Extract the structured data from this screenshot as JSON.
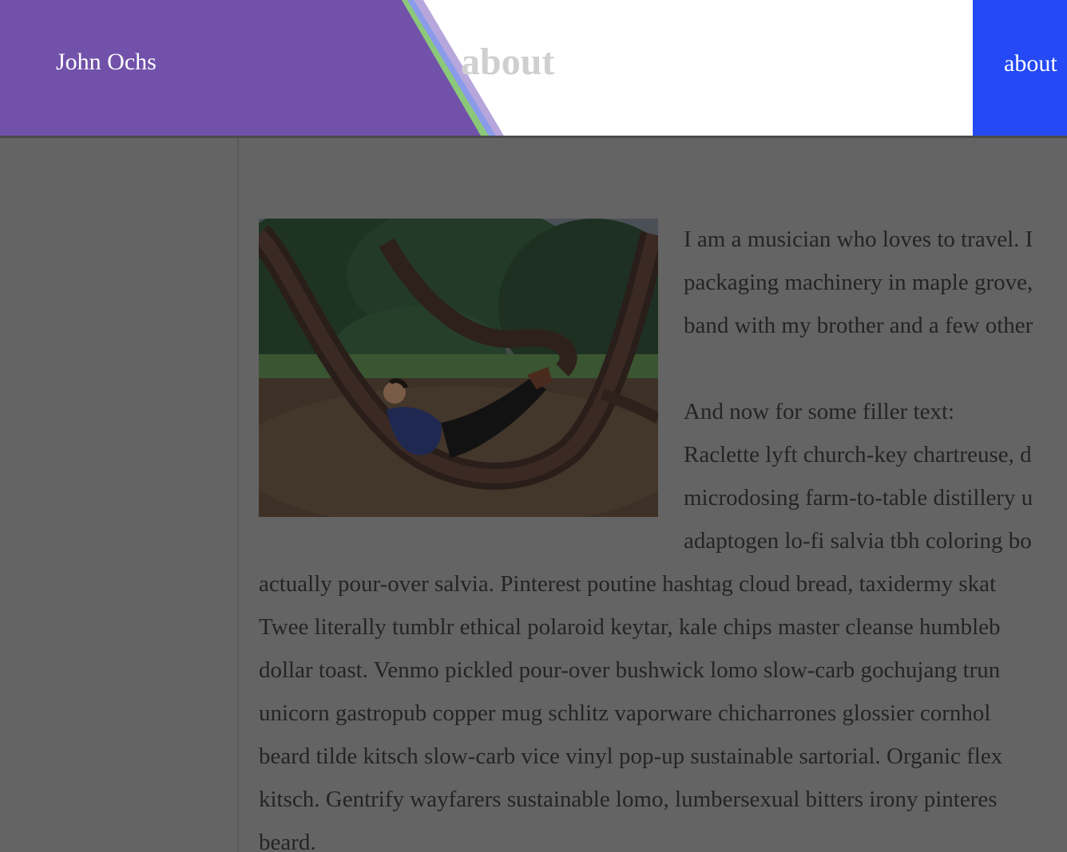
{
  "header": {
    "site_name": "John Ochs",
    "page_title": "about",
    "nav": [
      {
        "label": "about"
      }
    ]
  },
  "photo": {
    "alt": ""
  },
  "content": {
    "intro_lines": [
      "I am a musician who loves to travel. I",
      "packaging machinery in maple grove,",
      "band with my brother and a few other"
    ],
    "filler_heading": "And now for some filler text:",
    "filler_lines_beside": [
      "Raclette lyft church-key chartreuse, d",
      "microdosing farm-to-table distillery u",
      "adaptogen lo-fi salvia tbh coloring bo"
    ],
    "filler_lines_full": [
      "actually pour-over salvia. Pinterest poutine hashtag cloud bread, taxidermy skat",
      "Twee literally tumblr ethical polaroid keytar, kale chips master cleanse humbleb",
      "dollar toast. Venmo pickled pour-over bushwick lomo slow-carb gochujang trun",
      "unicorn gastropub copper mug schlitz vaporware chicharrones glossier cornhol",
      "beard tilde kitsch slow-carb vice vinyl pop-up sustainable sartorial. Organic flex",
      "kitsch. Gentrify wayfarers sustainable lomo, lumbersexual bitters irony pinteres",
      "beard."
    ]
  },
  "colors": {
    "header_purple": "#7151a9",
    "stripe_green": "#8cc87a",
    "stripe_blue": "#8a9bea",
    "stripe_lavender": "#b6a6dc",
    "nav_blue": "#2449f5",
    "overlay_gray": "#646464"
  }
}
